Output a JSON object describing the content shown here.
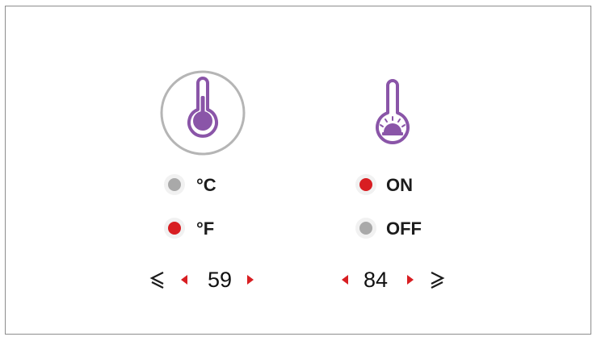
{
  "colors": {
    "accent": "#8a55a8",
    "selected": "#d81e22",
    "unselected": "#a9a9a9",
    "arrow": "#d81e22",
    "ring": "#b5b5b5"
  },
  "unit": {
    "icon": "thermometer-icon",
    "options": [
      {
        "label": "°C",
        "selected": false
      },
      {
        "label": "°F",
        "selected": true
      }
    ],
    "threshold": {
      "value": "59",
      "compare_symbol": "≤"
    }
  },
  "alarm": {
    "icon": "thermometer-alarm-icon",
    "options": [
      {
        "label": "ON",
        "selected": true
      },
      {
        "label": "OFF",
        "selected": false
      }
    ],
    "threshold": {
      "value": "84",
      "compare_symbol": "≥"
    }
  }
}
